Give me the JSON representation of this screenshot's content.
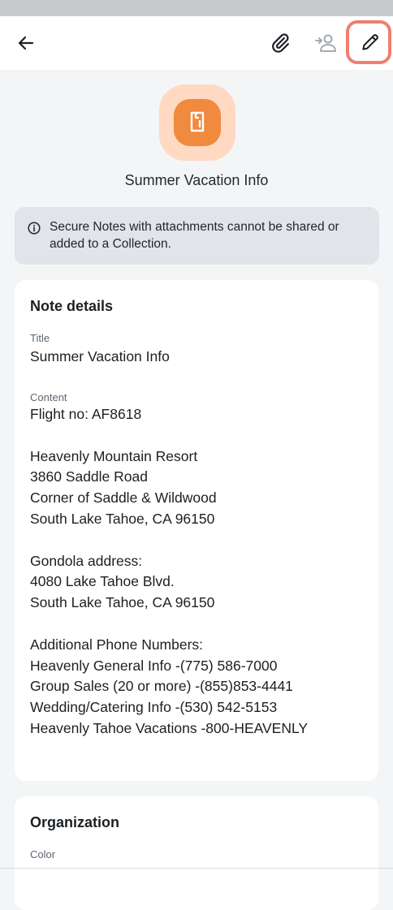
{
  "colors": {
    "accent": "#f08a3e",
    "accent_bg": "#ffd9c2",
    "highlight": "#f07e6e"
  },
  "toolbar": {
    "back_icon": "arrow-left-icon",
    "attachment_icon": "paperclip-icon",
    "share_icon": "move-to-organization-icon",
    "edit_icon": "pencil-icon"
  },
  "item": {
    "icon": "secure-note-icon",
    "name": "Summer Vacation Info"
  },
  "banner": {
    "icon": "info-icon",
    "text": "Secure Notes with attachments cannot be shared or added to a Collection."
  },
  "note_details": {
    "heading": "Note details",
    "title_label": "Title",
    "title_value": "Summer Vacation Info",
    "content_label": "Content",
    "content_value": "Flight no: AF8618\n\nHeavenly Mountain Resort\n3860 Saddle Road\nCorner of Saddle & Wildwood\nSouth Lake Tahoe, CA 96150\n\nGondola address:\n4080 Lake Tahoe Blvd.\nSouth Lake Tahoe, CA 96150\n\nAdditional Phone Numbers:\nHeavenly General Info -(775) 586-7000\nGroup Sales (20 or more) -(855)853-4441\nWedding/Catering Info -(530) 542-5153\nHeavenly Tahoe Vacations -800-HEAVENLY"
  },
  "organization": {
    "heading": "Organization",
    "color_label": "Color"
  }
}
